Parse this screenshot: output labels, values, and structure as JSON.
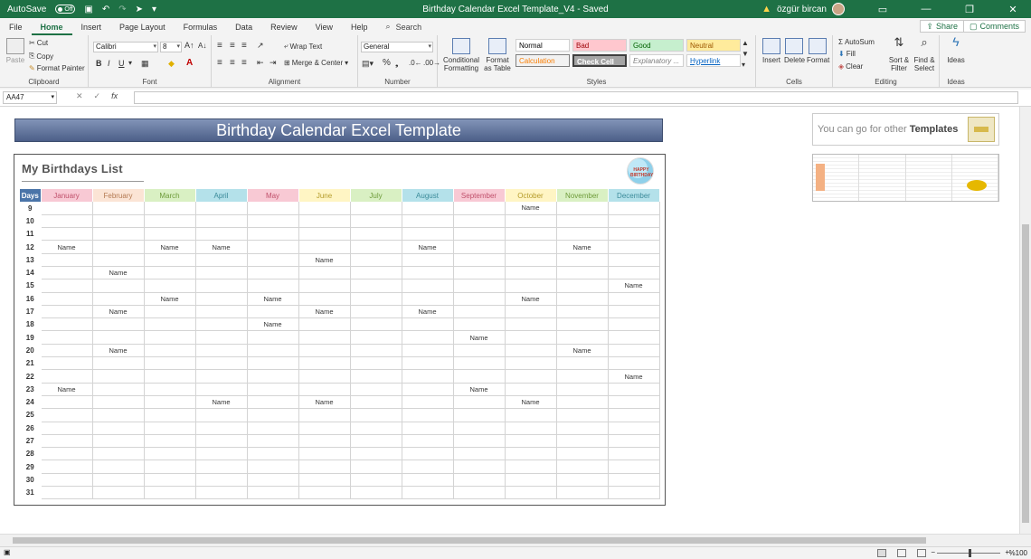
{
  "titlebar": {
    "autosave_label": "AutoSave",
    "autosave_state": "Off",
    "document_title": "Birthday Calendar Excel Template_V4  -  Saved",
    "user_name": "özgür bircan"
  },
  "tabs": [
    "File",
    "Home",
    "Insert",
    "Page Layout",
    "Formulas",
    "Data",
    "Review",
    "View",
    "Help"
  ],
  "active_tab": "Home",
  "tell_me": "Search",
  "share_label": "Share",
  "comments_label": "Comments",
  "ribbon": {
    "clipboard": {
      "paste": "Paste",
      "cut": "Cut",
      "copy": "Copy",
      "format_painter": "Format Painter",
      "label": "Clipboard"
    },
    "font": {
      "name": "Calibri",
      "size": "8",
      "label": "Font"
    },
    "alignment": {
      "wrap_text": "Wrap Text",
      "merge_center": "Merge & Center",
      "label": "Alignment"
    },
    "number": {
      "format": "General",
      "label": "Number"
    },
    "styles": {
      "conditional": "Conditional Formatting",
      "format_table": "Format as Table",
      "cells": [
        {
          "text": "Normal",
          "bg": "#ffffff",
          "color": "#000000"
        },
        {
          "text": "Bad",
          "bg": "#ffc7ce",
          "color": "#9c0006"
        },
        {
          "text": "Good",
          "bg": "#c6efce",
          "color": "#006100"
        },
        {
          "text": "Neutral",
          "bg": "#ffeb9c",
          "color": "#9c5700"
        },
        {
          "text": "Calculation",
          "bg": "#f2f2f2",
          "color": "#fa7d00"
        },
        {
          "text": "Check Cell",
          "bg": "#a5a5a5",
          "color": "#ffffff"
        },
        {
          "text": "Explanatory ...",
          "bg": "#ffffff",
          "color": "#7f7f7f"
        },
        {
          "text": "Hyperlink",
          "bg": "#ffffff",
          "color": "#0563c1"
        }
      ],
      "label": "Styles"
    },
    "cells": {
      "insert": "Insert",
      "delete": "Delete",
      "format": "Format",
      "label": "Cells"
    },
    "editing": {
      "autosum": "AutoSum",
      "fill": "Fill",
      "clear": "Clear",
      "sort": "Sort & Filter",
      "find": "Find & Select",
      "label": "Editing"
    },
    "ideas": {
      "label_btn": "Ideas",
      "label": "Ideas"
    }
  },
  "formula_bar": {
    "name_box": "AA47",
    "fx": "fx",
    "value": ""
  },
  "sheet": {
    "banner_title": "Birthday Calendar Excel Template",
    "promo_text_prefix": "You can go for other ",
    "promo_text_bold": "Templates",
    "card_title": "My Birthdays List",
    "badge_text": "HAPPY BIRTHDAY",
    "days_header": "Days",
    "months": [
      {
        "name": "January",
        "bg": "#f8c9d4",
        "color": "#c0506b"
      },
      {
        "name": "February",
        "bg": "#fbe4d5",
        "color": "#b47a52"
      },
      {
        "name": "March",
        "bg": "#d9f0c3",
        "color": "#6e9b3a"
      },
      {
        "name": "April",
        "bg": "#b4e1ea",
        "color": "#3a8a99"
      },
      {
        "name": "May",
        "bg": "#f8c9d4",
        "color": "#c0506b"
      },
      {
        "name": "June",
        "bg": "#fff5c4",
        "color": "#b59b2a"
      },
      {
        "name": "July",
        "bg": "#d9f0c3",
        "color": "#6e9b3a"
      },
      {
        "name": "August",
        "bg": "#b4e1ea",
        "color": "#3a8a99"
      },
      {
        "name": "September",
        "bg": "#f8c9d4",
        "color": "#c0506b"
      },
      {
        "name": "October",
        "bg": "#fff5c4",
        "color": "#b59b2a"
      },
      {
        "name": "November",
        "bg": "#d9f0c3",
        "color": "#6e9b3a"
      },
      {
        "name": "December",
        "bg": "#b4e1ea",
        "color": "#3a8a99"
      }
    ],
    "days": [
      "9",
      "10",
      "11",
      "12",
      "13",
      "14",
      "15",
      "16",
      "17",
      "18",
      "19",
      "20",
      "21",
      "22",
      "23",
      "24",
      "25",
      "26",
      "27",
      "28",
      "29",
      "30",
      "31"
    ],
    "entries": [
      {
        "day": "9",
        "month": 9,
        "text": "Name"
      },
      {
        "day": "12",
        "month": 0,
        "text": "Name"
      },
      {
        "day": "12",
        "month": 2,
        "text": "Name"
      },
      {
        "day": "12",
        "month": 3,
        "text": "Name"
      },
      {
        "day": "12",
        "month": 7,
        "text": "Name"
      },
      {
        "day": "12",
        "month": 10,
        "text": "Name"
      },
      {
        "day": "13",
        "month": 5,
        "text": "Name"
      },
      {
        "day": "14",
        "month": 1,
        "text": "Name"
      },
      {
        "day": "15",
        "month": 11,
        "text": "Name"
      },
      {
        "day": "16",
        "month": 2,
        "text": "Name"
      },
      {
        "day": "16",
        "month": 4,
        "text": "Name"
      },
      {
        "day": "16",
        "month": 9,
        "text": "Name"
      },
      {
        "day": "17",
        "month": 1,
        "text": "Name"
      },
      {
        "day": "17",
        "month": 5,
        "text": "Name"
      },
      {
        "day": "17",
        "month": 7,
        "text": "Name"
      },
      {
        "day": "18",
        "month": 4,
        "text": "Name"
      },
      {
        "day": "19",
        "month": 8,
        "text": "Name"
      },
      {
        "day": "20",
        "month": 1,
        "text": "Name"
      },
      {
        "day": "20",
        "month": 10,
        "text": "Name"
      },
      {
        "day": "22",
        "month": 11,
        "text": "Name"
      },
      {
        "day": "23",
        "month": 0,
        "text": "Name"
      },
      {
        "day": "23",
        "month": 8,
        "text": "Name"
      },
      {
        "day": "24",
        "month": 3,
        "text": "Name"
      },
      {
        "day": "24",
        "month": 5,
        "text": "Name"
      },
      {
        "day": "24",
        "month": 9,
        "text": "Name"
      }
    ]
  },
  "statusbar": {
    "zoom": "%100"
  }
}
